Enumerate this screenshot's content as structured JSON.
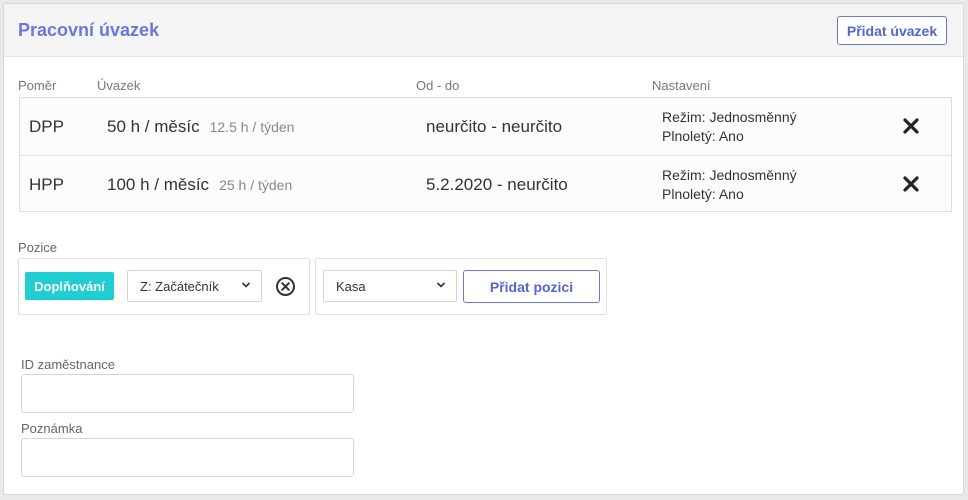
{
  "header": {
    "title": "Pracovní úvazek",
    "add_button": "Přidat úvazek"
  },
  "columns": {
    "pomer": "Poměr",
    "uvazek": "Úvazek",
    "od_do": "Od - do",
    "nastaveni": "Nastavení"
  },
  "rows": [
    {
      "pomer": "DPP",
      "uvazek": "50 h / měsíc",
      "tyden": "12.5 h / týden",
      "od_do": "neurčito - neurčito",
      "rezim": "Režim: Jednosměnný",
      "plnolety": "Plnoletý: Ano"
    },
    {
      "pomer": "HPP",
      "uvazek": "100 h / měsíc",
      "tyden": "25 h / týden",
      "od_do": "5.2.2020 - neurčito",
      "rezim": "Režim: Jednosměnný",
      "plnolety": "Plnoletý: Ano"
    }
  ],
  "pozice": {
    "label": "Pozice",
    "badge": "Doplňování",
    "level_select": "Z: Začátečník",
    "position_select": "Kasa",
    "add_button": "Přidat pozici"
  },
  "fields": {
    "employee_id_label": "ID zaměstnance",
    "employee_id_value": "",
    "note_label": "Poznámka",
    "note_value": ""
  },
  "colors": {
    "accent": "#6b78d8",
    "badge": "#1fcdd3"
  },
  "icons": {
    "remove": "close-icon",
    "clear": "clear-circle-icon",
    "dropdown": "chevron-down-icon"
  }
}
